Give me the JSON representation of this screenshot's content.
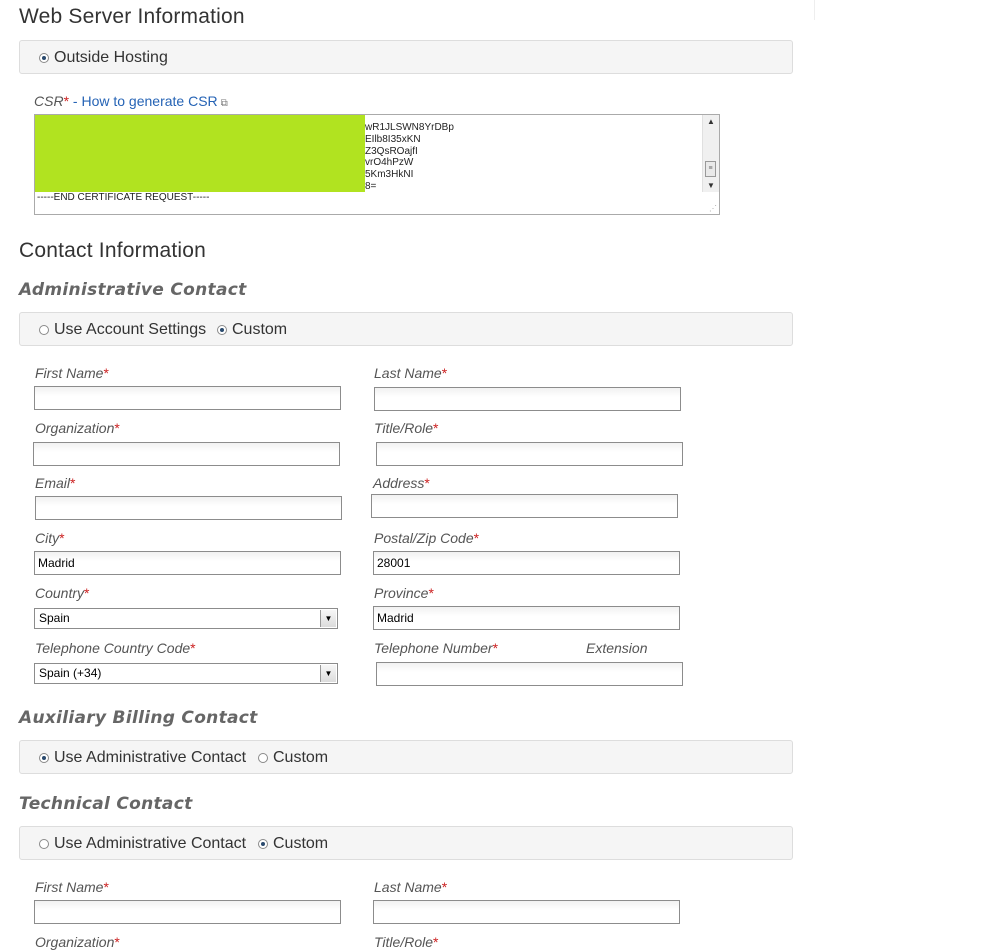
{
  "web_server": {
    "title": "Web Server Information",
    "hosting_option": "Outside Hosting"
  },
  "csr": {
    "label": "CSR",
    "separator": " - ",
    "link_text": "How to generate CSR",
    "lines": [
      "wR1JLSWN8YrDBp",
      "EIlb8I35xKN",
      "Z3QsROajfI",
      "vrO4hPzW",
      "5Km3HkNI",
      "8="
    ],
    "end_line": "-----END CERTIFICATE REQUEST-----"
  },
  "contact": {
    "title": "Contact Information",
    "admin": {
      "title": "Administrative Contact",
      "option_account": "Use Account Settings",
      "option_custom": "Custom",
      "labels": {
        "first_name": "First Name",
        "last_name": "Last Name",
        "organization": "Organization",
        "title_role": "Title/Role",
        "email": "Email",
        "address": "Address",
        "city": "City",
        "postal": "Postal/Zip Code",
        "country": "Country",
        "province": "Province",
        "tel_code": "Telephone Country Code",
        "tel_number": "Telephone Number",
        "extension": "Extension"
      },
      "values": {
        "first_name": "",
        "last_name": "",
        "organization": "",
        "title_role": "",
        "email": "",
        "address": "",
        "city": "Madrid",
        "postal": "28001",
        "country": "Spain",
        "province": "Madrid",
        "tel_code": "Spain (+34)",
        "tel_number": ""
      }
    },
    "billing": {
      "title": "Auxiliary Billing Contact",
      "option_admin": "Use Administrative Contact",
      "option_custom": "Custom"
    },
    "technical": {
      "title": "Technical Contact",
      "option_admin": "Use Administrative Contact",
      "option_custom": "Custom",
      "labels": {
        "first_name": "First Name",
        "last_name": "Last Name",
        "organization": "Organization",
        "title_role": "Title/Role"
      }
    }
  },
  "required_marker": "*",
  "icons": {
    "external_link": "external-link-icon",
    "dropdown": "chevron-down-icon",
    "scroll_up": "arrow-up-icon",
    "scroll_down": "arrow-down-icon",
    "resize": "resize-grip-icon"
  }
}
